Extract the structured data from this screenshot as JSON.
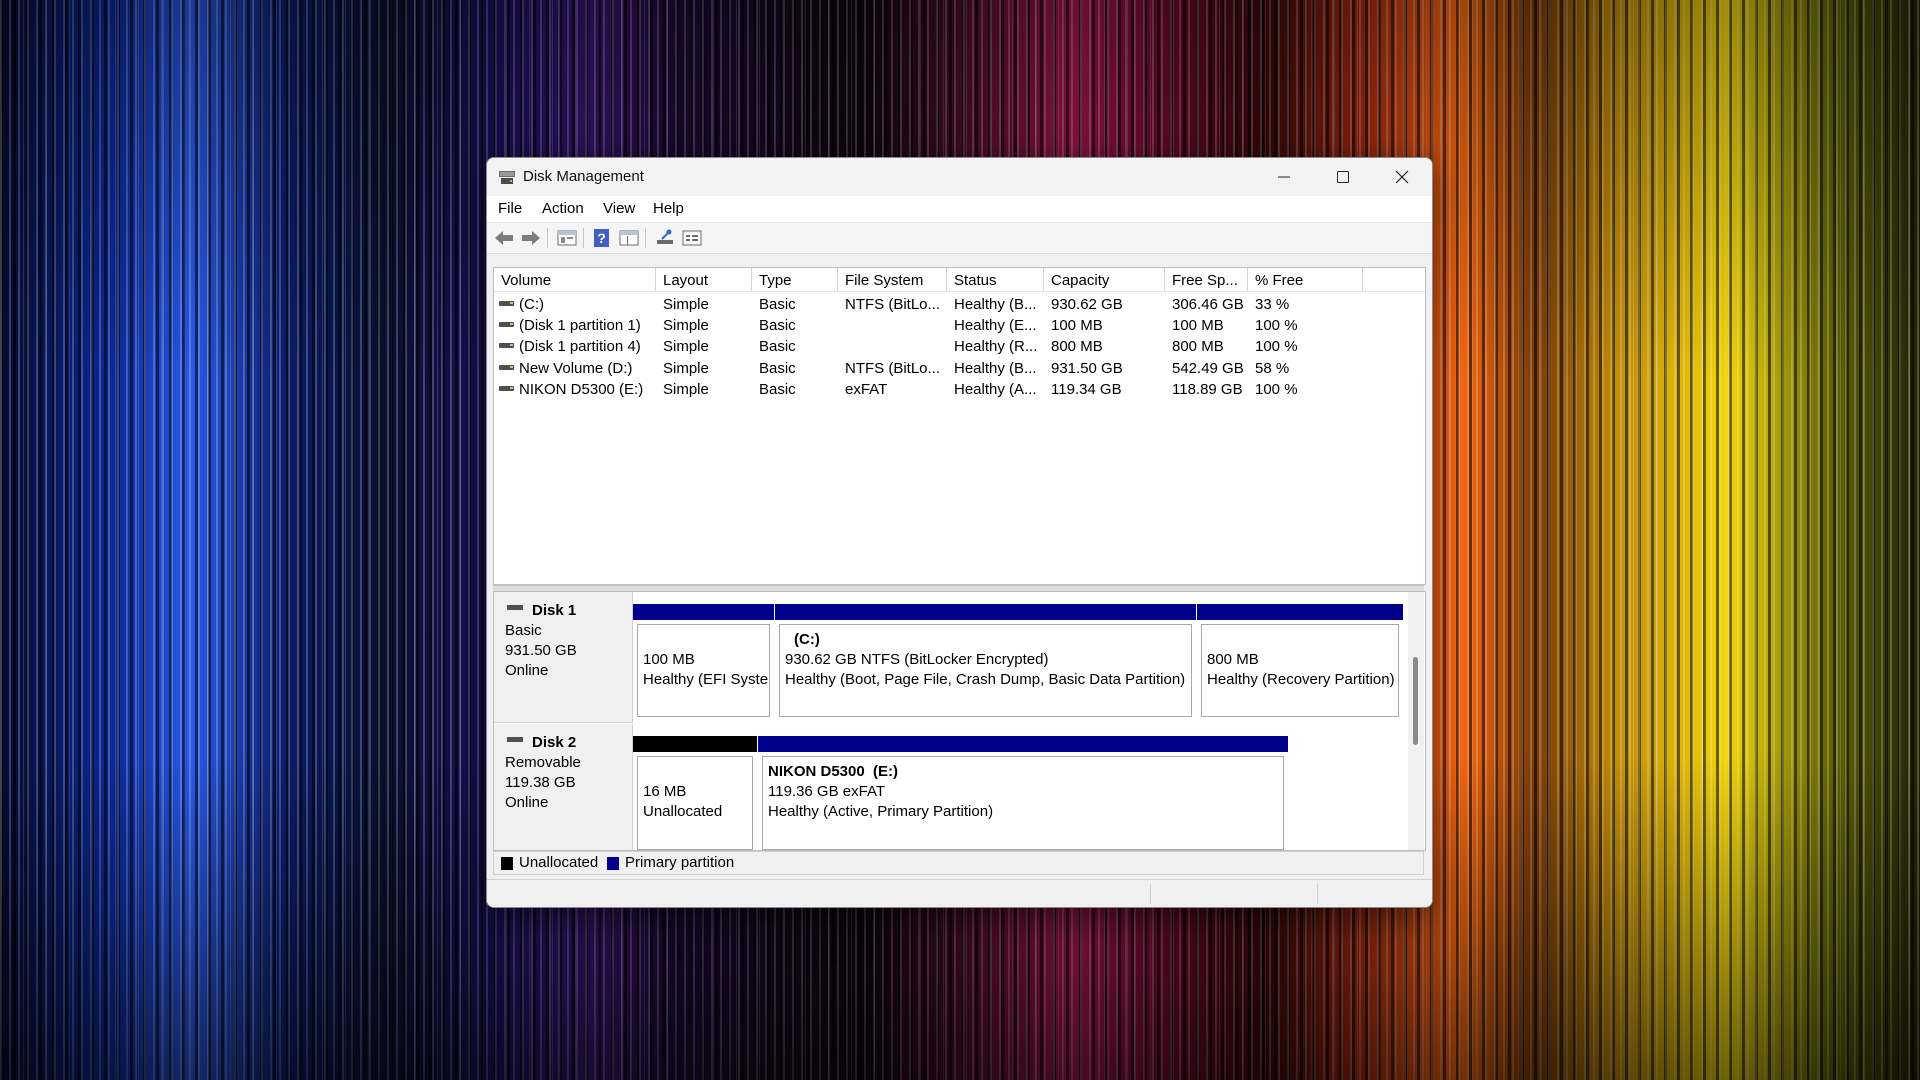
{
  "window": {
    "title": "Disk Management"
  },
  "menu": [
    "File",
    "Action",
    "View",
    "Help"
  ],
  "toolbar": [
    "back-icon",
    "forward-icon",
    "properties-icon",
    "help-icon",
    "console-tree-icon",
    "rescan-disks-icon",
    "settings-icon"
  ],
  "volume_list": {
    "columns": [
      "Volume",
      "Layout",
      "Type",
      "File System",
      "Status",
      "Capacity",
      "Free Sp...",
      "% Free"
    ],
    "rows": [
      [
        "(C:)",
        "Simple",
        "Basic",
        "NTFS (BitLo...",
        "Healthy (B...",
        "930.62 GB",
        "306.46 GB",
        "33 %"
      ],
      [
        "(Disk 1 partition 1)",
        "Simple",
        "Basic",
        "",
        "Healthy (E...",
        "100 MB",
        "100 MB",
        "100 %"
      ],
      [
        "(Disk 1 partition 4)",
        "Simple",
        "Basic",
        "",
        "Healthy (R...",
        "800 MB",
        "800 MB",
        "100 %"
      ],
      [
        "New Volume (D:)",
        "Simple",
        "Basic",
        "NTFS (BitLo...",
        "Healthy (B...",
        "931.50 GB",
        "542.49 GB",
        "58 %"
      ],
      [
        "NIKON D5300 (E:)",
        "Simple",
        "Basic",
        "exFAT",
        "Healthy (A...",
        "119.34 GB",
        "118.89 GB",
        "100 %"
      ]
    ]
  },
  "disks": [
    {
      "name": "Disk 1",
      "type": "Basic",
      "size": "931.50 GB",
      "state": "Online",
      "partitions": [
        {
          "title": "",
          "size": "100 MB",
          "status": "Healthy (EFI System Partition)",
          "kind": "primary"
        },
        {
          "title": "(C:)",
          "size": "930.62 GB NTFS (BitLocker Encrypted)",
          "status": "Healthy (Boot, Page File, Crash Dump, Basic Data Partition)",
          "kind": "primary"
        },
        {
          "title": "",
          "size": "800 MB",
          "status": "Healthy (Recovery Partition)",
          "kind": "primary"
        }
      ]
    },
    {
      "name": "Disk 2",
      "type": "Removable",
      "size": "119.38 GB",
      "state": "Online",
      "partitions": [
        {
          "title": "",
          "size": "16 MB",
          "status": "Unallocated",
          "kind": "unallocated"
        },
        {
          "title": "NIKON D5300  (E:)",
          "size": "119.36 GB exFAT",
          "status": "Healthy (Active, Primary Partition)",
          "kind": "primary"
        }
      ]
    }
  ],
  "legend": [
    {
      "label": "Unallocated",
      "color": "#000000"
    },
    {
      "label": "Primary partition",
      "color": "#00008b"
    }
  ],
  "colors": {
    "primary": "#00008b",
    "unallocated": "#000000",
    "window_bg": "#f0f0f0"
  }
}
